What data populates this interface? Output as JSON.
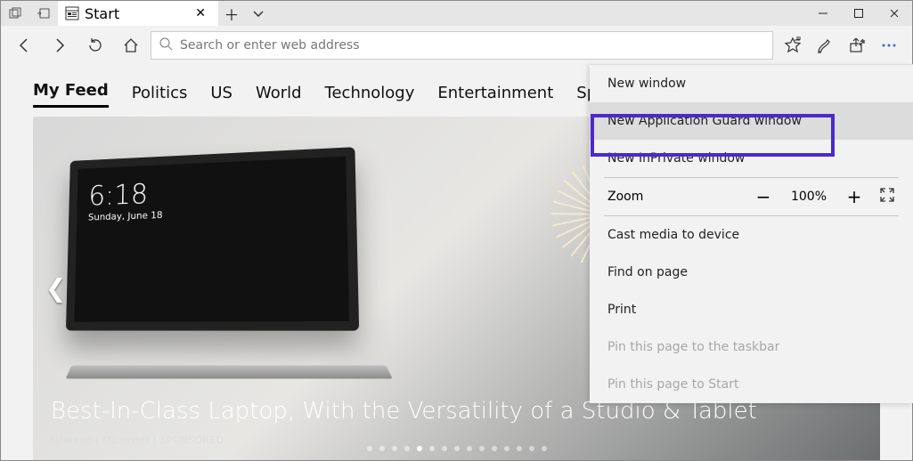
{
  "tab": {
    "title": "Start"
  },
  "omnibox": {
    "placeholder": "Search or enter web address"
  },
  "feed": {
    "tabs": [
      "My Feed",
      "Politics",
      "US",
      "World",
      "Technology",
      "Entertainment",
      "Sports"
    ],
    "activeIndex": 0
  },
  "hero": {
    "clock_time": "6:18",
    "clock_date": "Sunday, June 18",
    "headline": "Best-In-Class Laptop, With the Versatility of a Studio & Tablet",
    "byline": "Newegg | Microsoft | SPONSORED",
    "dot_count": 15,
    "active_dot": 4
  },
  "menu": {
    "items": {
      "new_window": "New window",
      "new_app_guard": "New Application Guard window",
      "new_inprivate": "New InPrivate window",
      "zoom_label": "Zoom",
      "zoom_value": "100%",
      "cast": "Cast media to device",
      "find": "Find on page",
      "print": "Print",
      "pin_taskbar": "Pin this page to the taskbar",
      "pin_start": "Pin this page to Start"
    },
    "highlighted": "new_app_guard"
  }
}
